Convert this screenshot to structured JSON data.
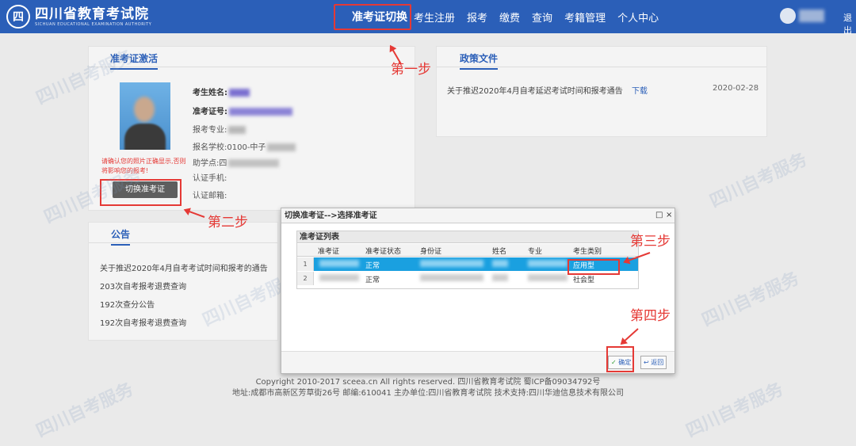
{
  "header": {
    "logo_mark": "四",
    "logo_cn": "四川省教育考试院",
    "logo_en": "SICHUAN EDUCATIONAL EXAMINATION AUTHORITY",
    "nav": [
      "准考证切换",
      "考生注册",
      "报考",
      "缴费",
      "查询",
      "考籍管理",
      "个人中心"
    ],
    "logout": "退出"
  },
  "activation_panel": {
    "tab": "准考证激活",
    "labels": {
      "name": "考生姓名:",
      "ticket": "准考证号:",
      "major": "报考专业:",
      "school": "报名学校:",
      "assist": "助学点:",
      "phone": "认证手机:",
      "email": "认证邮箱:"
    },
    "school_partial": "0100-中子",
    "assist_partial": "四",
    "photo_note": "请确认您的照片正确显示,否则将影响您的报考!",
    "switch_button": "切换准考证"
  },
  "notice_panel": {
    "tab": "公告",
    "items": [
      "关于推迟2020年4月自考考试时间和报考的通告",
      "203次自考报考退费查询",
      "192次查分公告",
      "192次自考报考退费查询"
    ]
  },
  "policy_panel": {
    "tab": "政策文件",
    "items": [
      {
        "title": "关于推迟2020年4月自考延迟考试时间和报考通告",
        "action": "下载",
        "date": "2020-02-28"
      }
    ]
  },
  "footer": {
    "line1": "Copyright 2010-2017 sceea.cn All rights reserved. 四川省教育考试院 蜀ICP备09034792号",
    "line2": "地址:成都市高新区芳草街26号 邮编:610041 主办单位:四川省教育考试院 技术支持:四川华迪信息技术有限公司"
  },
  "dialog": {
    "title": "切换准考证-->选择准考证",
    "grid_title": "准考证列表",
    "columns": [
      "准考证",
      "准考证状态",
      "身份证",
      "姓名",
      "专业",
      "考生类别"
    ],
    "rows": [
      {
        "no": "1",
        "status": "正常",
        "category": "应用型"
      },
      {
        "no": "2",
        "status": "正常",
        "category": "社会型"
      }
    ],
    "confirm": "确定",
    "back": "返回",
    "minimize_icon": "□",
    "close_icon": "×"
  },
  "annotations": {
    "step1": "第一步",
    "step2": "第二步",
    "step3": "第三步",
    "step4": "第四步"
  },
  "watermark": "四川自考服务",
  "colors": {
    "brand_blue": "#2b5fb8",
    "highlight": "#1aa0e0",
    "annotation_red": "#e53935"
  }
}
